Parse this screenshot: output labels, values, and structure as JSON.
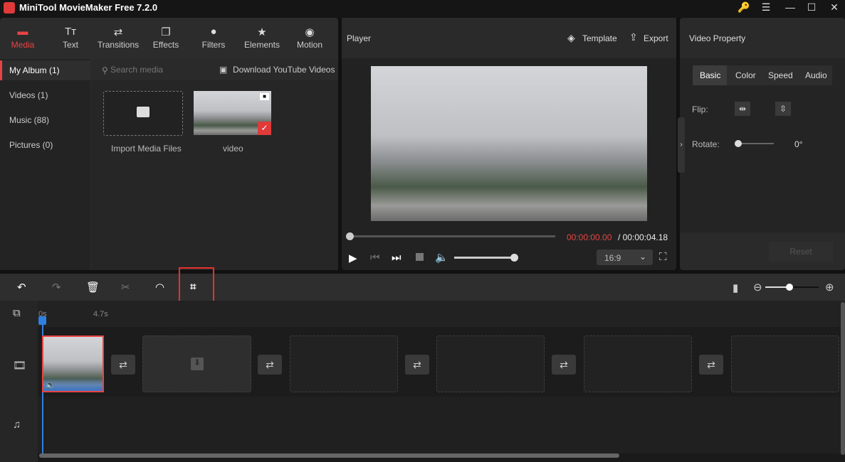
{
  "app": {
    "title": "MiniTool MovieMaker Free 7.2.0"
  },
  "window": {
    "key": "🔑",
    "menu": "☰",
    "minimize": "—",
    "maximize": "☐",
    "close": "✕"
  },
  "toolbar": [
    {
      "label": "Media",
      "icon": "▬",
      "active": true
    },
    {
      "label": "Text",
      "icon": "Tт"
    },
    {
      "label": "Transitions",
      "icon": "⇄"
    },
    {
      "label": "Effects",
      "icon": "❐"
    },
    {
      "label": "Filters",
      "icon": "●"
    },
    {
      "label": "Elements",
      "icon": "★"
    },
    {
      "label": "Motion",
      "icon": "◉"
    }
  ],
  "sidebar": {
    "items": [
      {
        "label": "My Album (1)",
        "active": true
      },
      {
        "label": "Videos (1)"
      },
      {
        "label": "Music (88)"
      },
      {
        "label": "Pictures (0)"
      }
    ]
  },
  "media": {
    "search_placeholder": "Search media",
    "download": "Download YouTube Videos",
    "import_label": "Import Media Files",
    "video_label": "video"
  },
  "player": {
    "title": "Player",
    "template": "Template",
    "export": "Export",
    "current_time": "00:00:00.00",
    "total_time": "/ 00:00:04.18",
    "aspect": "16:9",
    "progress": 0,
    "volume": 1.0
  },
  "property": {
    "title": "Video Property",
    "tabs": [
      "Basic",
      "Color",
      "Speed",
      "Audio"
    ],
    "active_tab": "Basic",
    "flip_label": "Flip:",
    "rotate_label": "Rotate:",
    "rotate_value": "0°",
    "reset": "Reset"
  },
  "timeline": {
    "ruler": [
      "0s",
      "4.7s"
    ],
    "zoom": 0.45
  },
  "colors": {
    "accent": "#e84444",
    "playhead": "#2f7fe0"
  }
}
